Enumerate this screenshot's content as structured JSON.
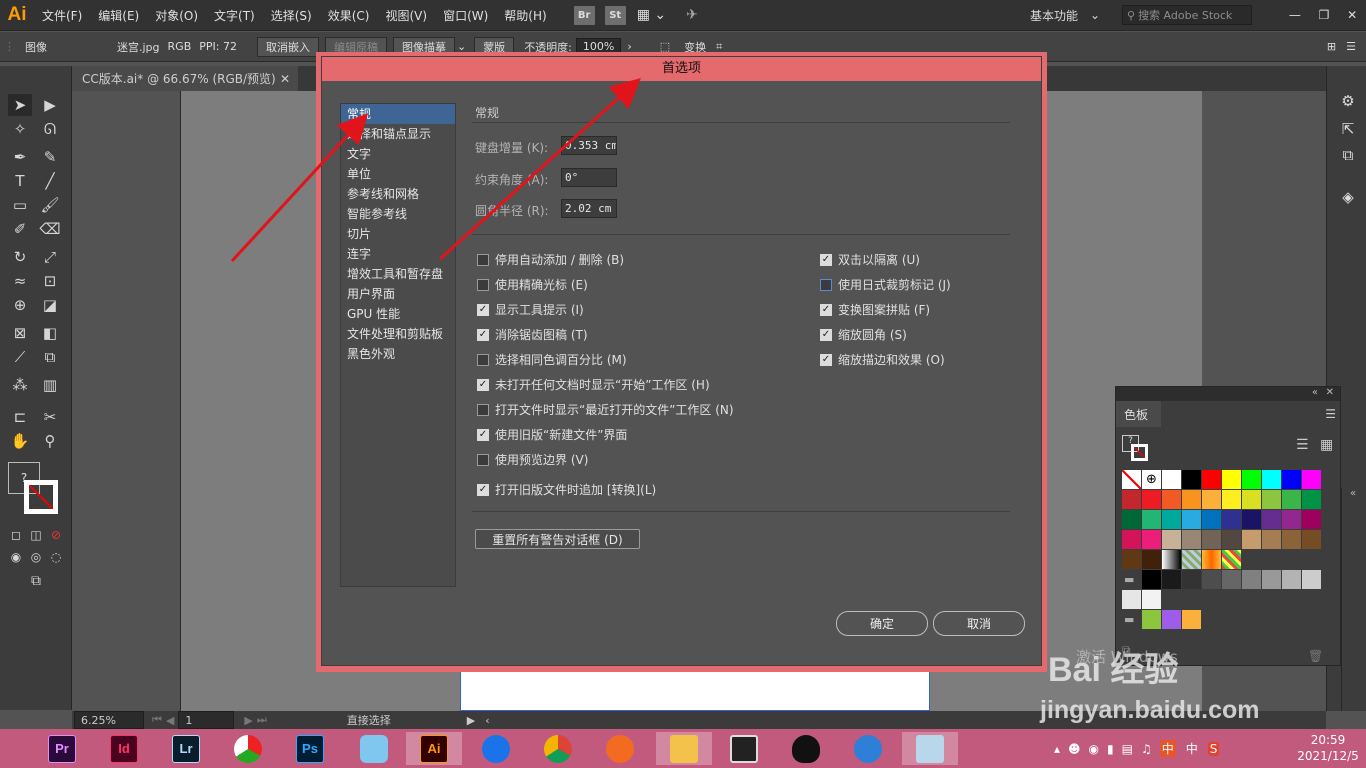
{
  "menubar": {
    "logo": "Ai",
    "items": [
      "文件(F)",
      "编辑(E)",
      "对象(O)",
      "文字(T)",
      "选择(S)",
      "效果(C)",
      "视图(V)",
      "窗口(W)",
      "帮助(H)"
    ],
    "bridge_btn": "Br",
    "stock_btn": "St",
    "workspace_label": "基本功能",
    "stock_search_placeholder": "搜索 Adobe Stock"
  },
  "controlbar": {
    "object_type": "图像",
    "file_name": "迷宫.jpg",
    "color_mode": "RGB",
    "ppi": "PPI: 72",
    "embed_btn": "取消嵌入",
    "edit_original_btn": "编辑原稿",
    "image_trace_btn": "图像描摹",
    "mask_btn": "蒙版",
    "opacity_label": "不透明度:",
    "opacity_value": "100%",
    "transform_btn": "变换"
  },
  "document_tab": {
    "title": "CC版本.ai* @ 66.67% (RGB/预览)"
  },
  "statusbar": {
    "zoom": "6.25%",
    "artboard": "1",
    "tool_name": "直接选择"
  },
  "dialog": {
    "title": "首选项",
    "categories": [
      "常规",
      "选择和锚点显示",
      "文字",
      "单位",
      "参考线和网格",
      "智能参考线",
      "切片",
      "连字",
      "增效工具和暂存盘",
      "用户界面",
      "GPU 性能",
      "文件处理和剪贴板",
      "黑色外观"
    ],
    "section_title": "常规",
    "fields": [
      {
        "label": "键盘增量 (K):",
        "value": "0.353 cm"
      },
      {
        "label": "约束角度 (A):",
        "value": "0°"
      },
      {
        "label": "圆角半径 (R):",
        "value": "2.02 cm"
      }
    ],
    "left_options": [
      {
        "label": "停用自动添加 / 删除 (B)",
        "checked": false
      },
      {
        "label": "使用精确光标 (E)",
        "checked": false
      },
      {
        "label": "显示工具提示 (I)",
        "checked": true
      },
      {
        "label": "消除锯齿图稿 (T)",
        "checked": true
      },
      {
        "label": "选择相同色调百分比 (M)",
        "checked": false
      },
      {
        "label": "未打开任何文档时显示“开始”工作区 (H)",
        "checked": true
      },
      {
        "label": "打开文件时显示“最近打开的文件”工作区 (N)",
        "checked": false
      },
      {
        "label": "使用旧版“新建文件”界面",
        "checked": true
      },
      {
        "label": "使用预览边界 (V)",
        "checked": false
      },
      {
        "label": "打开旧版文件时追加 [转换](L)",
        "checked": true
      }
    ],
    "right_options": [
      {
        "label": "双击以隔离 (U)",
        "checked": true
      },
      {
        "label": "使用日式裁剪标记 (J)",
        "checked": false
      },
      {
        "label": "变换图案拼贴 (F)",
        "checked": true
      },
      {
        "label": "缩放圆角 (S)",
        "checked": true
      },
      {
        "label": "缩放描边和效果 (O)",
        "checked": true
      }
    ],
    "reset_btn": "重置所有警告对话框 (D)",
    "ok_btn": "确定",
    "cancel_btn": "取消"
  },
  "swatches": {
    "title": "色板",
    "colors": [
      "#ffffff",
      "#000000",
      "#ff0000",
      "#ffff00",
      "#00ff00",
      "#00ffff",
      "#0000ff",
      "#ff00ff",
      "#c1272d",
      "#ed1c24",
      "#f15a24",
      "#f7931e",
      "#fbb03b",
      "#fcee21",
      "#d9e021",
      "#8cc63f",
      "#39b54a",
      "#009245",
      "#006837",
      "#22b573",
      "#00a99d",
      "#29abe2",
      "#0071bc",
      "#2e3192",
      "#1b1464",
      "#662d91",
      "#93278f",
      "#9e005d",
      "#d4145a",
      "#ed1e79",
      "#c7b299",
      "#998675",
      "#736357",
      "#534741",
      "#c69c6d",
      "#a67c52",
      "#8c6239",
      "#754c24",
      "#603813",
      "#42210b",
      "#000000",
      "#1a1a1a",
      "#333333",
      "#4d4d4d",
      "#666666",
      "#808080",
      "#999999",
      "#b3b3b3",
      "#cccccc",
      "#e6e6e6",
      "#f2f2f2",
      "#8cc63f",
      "#9e5de8",
      "#fbb03b"
    ]
  },
  "watermark": {
    "logo": "Bai 经验",
    "url": "jingyan.baidu.com",
    "activate": "激活 Windows"
  },
  "taskbar": {
    "apps": [
      "Pr",
      "Id",
      "Lr",
      "",
      "Ps",
      "",
      "Ai",
      "",
      "",
      "",
      "",
      "",
      "",
      "",
      ""
    ],
    "tray_ime": "中",
    "time": "20:59",
    "date": "2021/12/5"
  }
}
